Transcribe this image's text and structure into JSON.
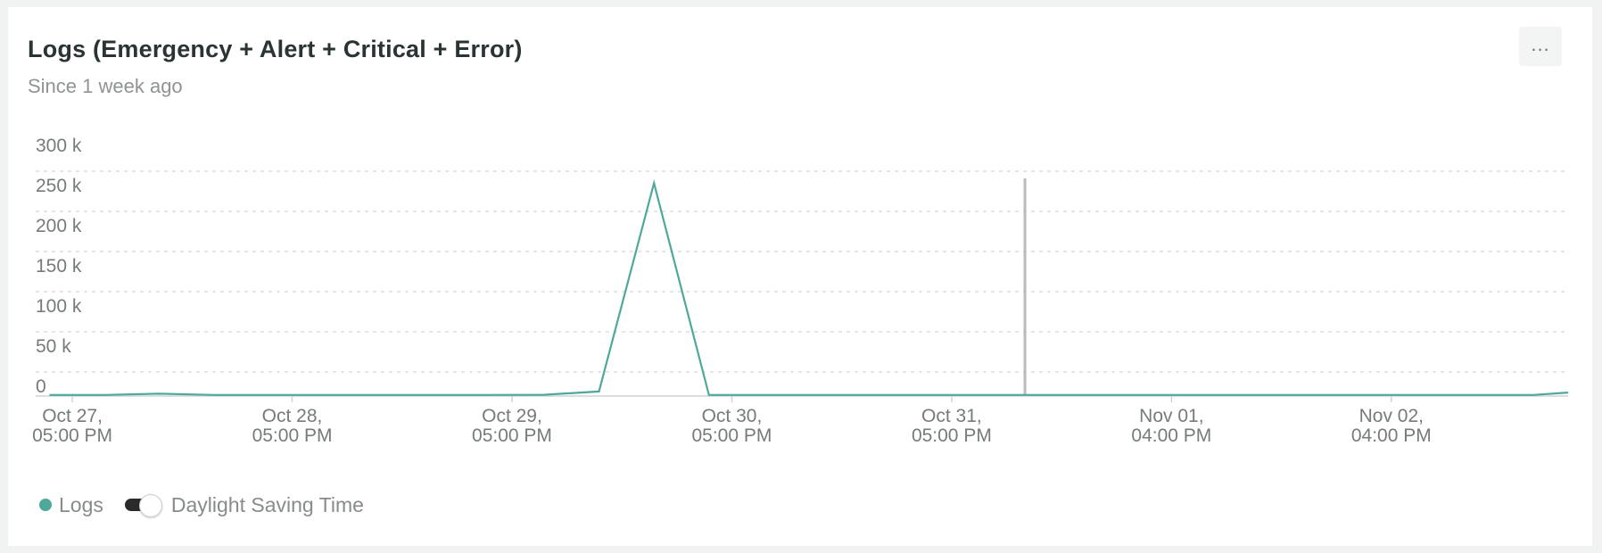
{
  "widget": {
    "title": "Logs (Emergency + Alert + Critical + Error)",
    "subtitle": "Since 1 week ago",
    "menu_label": "...",
    "menu_icon": "ellipsis-icon"
  },
  "legend": {
    "series_label": "Logs",
    "toggle_label": "Daylight Saving Time",
    "toggle_on": false
  },
  "colors": {
    "series": "#4fa89a",
    "marker": "#b8bcbc",
    "grid": "#d4d8d8",
    "axis": "#cfd3d3"
  },
  "chart_data": {
    "type": "line",
    "title": "Logs (Emergency + Alert + Critical + Error)",
    "subtitle": "Since 1 week ago",
    "xlabel": "",
    "ylabel": "",
    "ylim": [
      0,
      300000
    ],
    "y_ticks": [
      {
        "value": 0,
        "label": "0"
      },
      {
        "value": 50000,
        "label": "50 k"
      },
      {
        "value": 100000,
        "label": "100 k"
      },
      {
        "value": 150000,
        "label": "150 k"
      },
      {
        "value": 200000,
        "label": "200 k"
      },
      {
        "value": 250000,
        "label": "250 k"
      },
      {
        "value": 300000,
        "label": "300 k"
      }
    ],
    "x_domain_hours": [
      -4.0,
      163.3
    ],
    "x_ticks": [
      {
        "hour": 0,
        "line1": "Oct 27,",
        "line2": "05:00 PM"
      },
      {
        "hour": 24,
        "line1": "Oct 28,",
        "line2": "05:00 PM"
      },
      {
        "hour": 48,
        "line1": "Oct 29,",
        "line2": "05:00 PM"
      },
      {
        "hour": 72,
        "line1": "Oct 30,",
        "line2": "05:00 PM"
      },
      {
        "hour": 96,
        "line1": "Oct 31,",
        "line2": "05:00 PM"
      },
      {
        "hour": 120,
        "line1": "Nov 01,",
        "line2": "04:00 PM"
      },
      {
        "hour": 144,
        "line1": "Nov 02,",
        "line2": "04:00 PM"
      }
    ],
    "marker_hour": 104.0,
    "grid": true,
    "legend_position": "bottom-left",
    "series": [
      {
        "name": "Logs",
        "x_hours": [
          -2.5,
          3.5,
          9.5,
          15.5,
          21.5,
          27.5,
          33.5,
          39.5,
          45.5,
          51.5,
          57.5,
          63.5,
          69.5,
          75.5,
          81.5,
          87.5,
          93.5,
          99.5,
          105.5,
          111.5,
          117.5,
          123.5,
          129.5,
          135.5,
          141.5,
          147.5,
          153.5,
          159.5,
          163.3
        ],
        "values": [
          200,
          200,
          1800,
          200,
          200,
          200,
          200,
          200,
          200,
          400,
          4500,
          264000,
          200,
          200,
          200,
          200,
          200,
          200,
          200,
          200,
          200,
          200,
          200,
          200,
          200,
          200,
          200,
          200,
          3200
        ]
      }
    ]
  }
}
